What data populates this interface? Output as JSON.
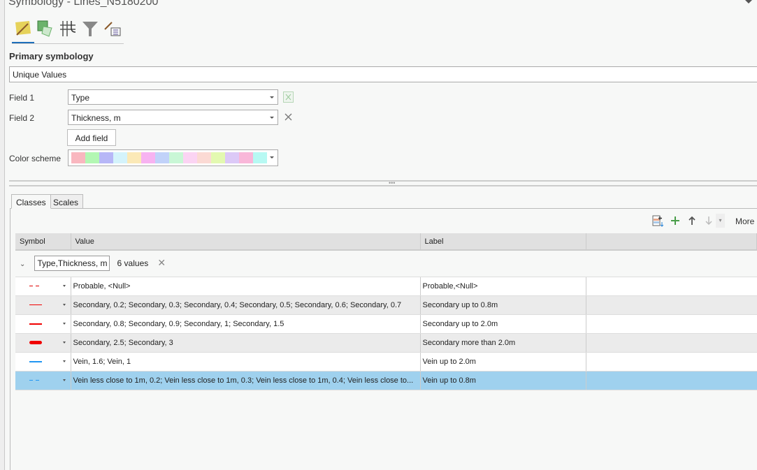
{
  "pane": {
    "title": "Symbology - Lines_N5180200"
  },
  "icons": [
    "primary-symbology-icon",
    "vary-symbology-icon",
    "symbol-layer-drawing-icon",
    "symbol-filter-icon",
    "label-classes-icon"
  ],
  "primary": {
    "heading": "Primary symbology",
    "method": "Unique Values"
  },
  "fields": {
    "field1_label": "Field 1",
    "field1_value": "Type",
    "field2_label": "Field 2",
    "field2_value": "Thickness, m",
    "add_field": "Add field",
    "color_scheme_label": "Color scheme",
    "scheme_colors": [
      "#f9b7bf",
      "#b3f7b3",
      "#b7b7f7",
      "#d4f3fb",
      "#fbe9b7",
      "#f7b3f1",
      "#c1d2f9",
      "#c9f7d6",
      "#fbd4f3",
      "#fbdad4",
      "#e3f9b1",
      "#dcc9f7",
      "#f9b7d9",
      "#b7f9f3"
    ]
  },
  "tabs": [
    "Classes",
    "Scales"
  ],
  "toolbar": {
    "more": "More"
  },
  "table": {
    "headers": [
      "Symbol",
      "Value",
      "Label"
    ],
    "group": {
      "field": "Type,Thickness, m",
      "count": "6 values"
    },
    "rows": [
      {
        "value": "Probable, <Null>",
        "label": "Probable,<Null>",
        "color": "#e00000",
        "style": "dashed",
        "width": 1
      },
      {
        "value": "Secondary, 0.2; Secondary, 0.3; Secondary, 0.4; Secondary, 0.5; Secondary, 0.6; Secondary, 0.7",
        "label": "Secondary up to 0.8m",
        "color": "#f00000",
        "style": "solid",
        "width": 1
      },
      {
        "value": "Secondary, 0.8; Secondary, 0.9; Secondary, 1; Secondary, 1.5",
        "label": "Secondary up to 2.0m",
        "color": "#f00000",
        "style": "solid",
        "width": 2
      },
      {
        "value": "Secondary, 2.5; Secondary, 3",
        "label": "Secondary more than 2.0m",
        "color": "#f00000",
        "style": "solid",
        "width": 5
      },
      {
        "value": "Vein, 1.6; Vein, 1",
        "label": "Vein up to 2.0m",
        "color": "#2196f3",
        "style": "solid",
        "width": 2
      },
      {
        "value": "Vein less close to 1m, 0.2; Vein less close to 1m, 0.3; Vein less close to 1m, 0.4; Vein less close to...",
        "label": "Vein up to 0.8m",
        "color": "#2196f3",
        "style": "dashed",
        "width": 1
      }
    ]
  }
}
